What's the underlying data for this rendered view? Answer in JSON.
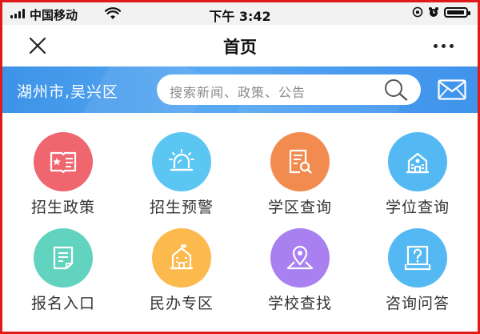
{
  "status_bar": {
    "carrier": "中国移动",
    "time": "下午 3:42"
  },
  "nav": {
    "title": "首页"
  },
  "header": {
    "region": "湖州市,吴兴区",
    "search_placeholder": "搜索新闻、政策、公告"
  },
  "grid": [
    {
      "label": "招生政策",
      "icon": "flag-book-icon",
      "color": "#f0666f"
    },
    {
      "label": "招生预警",
      "icon": "alarm-light-icon",
      "color": "#5bc6f2"
    },
    {
      "label": "学区查询",
      "icon": "document-search-icon",
      "color": "#f28b4f"
    },
    {
      "label": "学位查询",
      "icon": "school-building-icon",
      "color": "#54b9f3"
    },
    {
      "label": "报名入口",
      "icon": "form-list-icon",
      "color": "#62d3bf"
    },
    {
      "label": "民办专区",
      "icon": "building-icon",
      "color": "#fcb94e"
    },
    {
      "label": "学校查找",
      "icon": "map-pin-icon",
      "color": "#a980f0"
    },
    {
      "label": "咨询问答",
      "icon": "question-icon",
      "color": "#54b9f3"
    }
  ]
}
